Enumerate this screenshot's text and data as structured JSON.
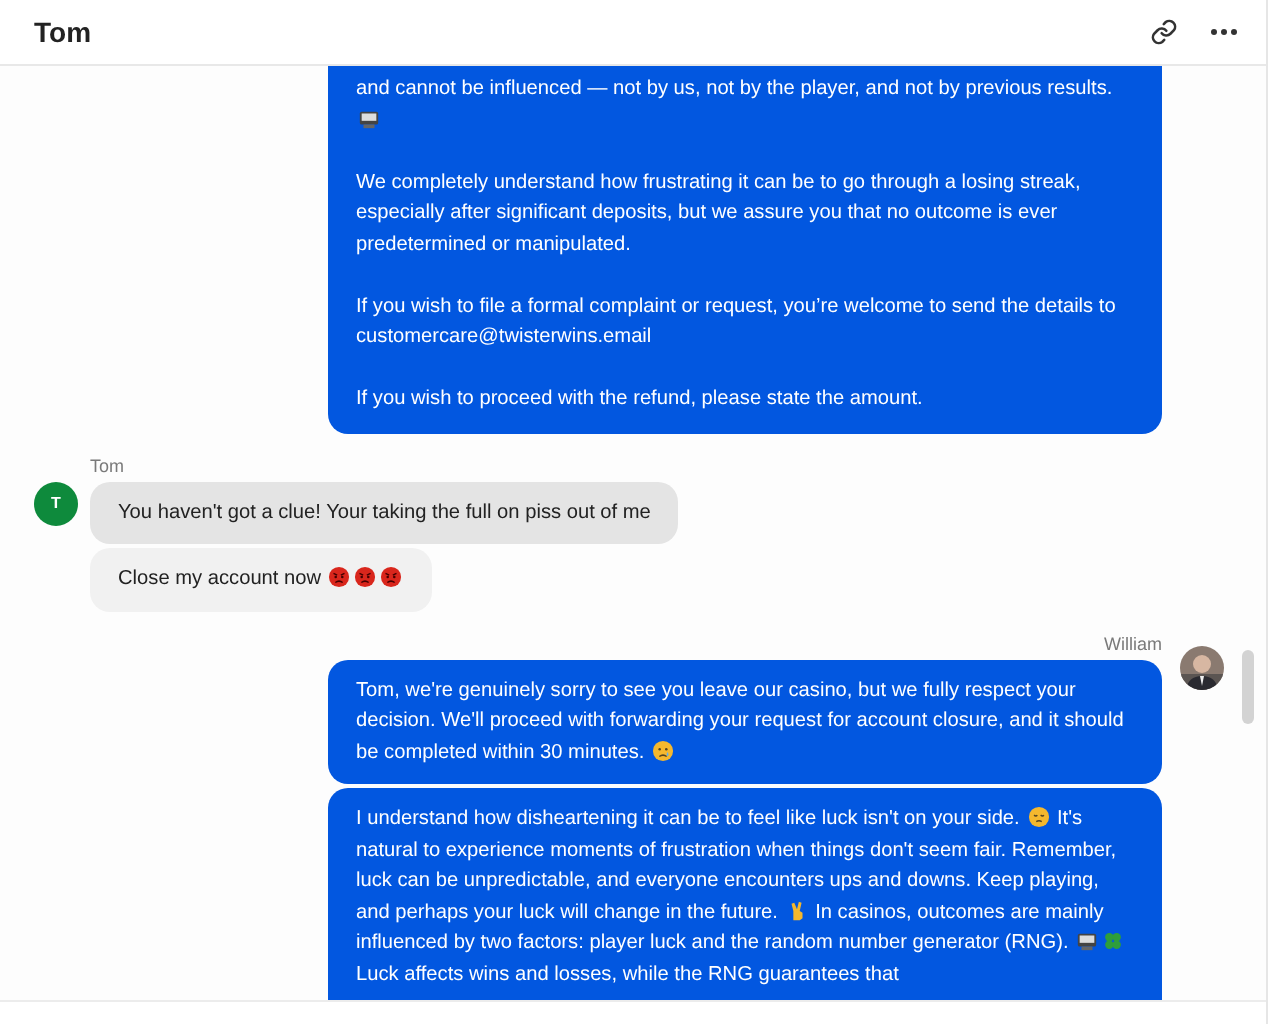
{
  "header": {
    "title": "Tom"
  },
  "messages": [
    {
      "kind": "outgoing",
      "paragraphs": [
        [
          {
            "kind": "text",
            "text": "and cannot be influenced — not by us, not by the player, and not by previous results. "
          },
          {
            "kind": "monitor"
          }
        ],
        [
          {
            "kind": "text",
            "text": "We completely understand how frustrating it can be to go through a losing streak, especially after significant deposits, but we assure you that no outcome is ever predetermined or manipulated."
          }
        ],
        [
          {
            "kind": "text",
            "text": "If you wish to file a formal complaint or request, you’re welcome to send the details to customercare@twisterwins.email"
          }
        ],
        [
          {
            "kind": "text",
            "text": "If you wish to proceed with the refund, please state the amount."
          }
        ]
      ]
    },
    {
      "kind": "incoming",
      "sender": "Tom",
      "avatar": "T",
      "paragraphs": [
        [
          {
            "kind": "text",
            "text": "You haven't got a clue! Your taking the full on piss out of me"
          }
        ]
      ]
    },
    {
      "kind": "incoming",
      "paragraphs": [
        [
          {
            "kind": "text",
            "text": "Close my account now "
          },
          {
            "kind": "angry"
          },
          {
            "kind": "angry"
          },
          {
            "kind": "angry"
          }
        ]
      ]
    },
    {
      "kind": "outgoing",
      "sender": "William",
      "paragraphs": [
        [
          {
            "kind": "text",
            "text": "Tom, we're genuinely sorry to see you leave our casino, but we fully respect your decision. We'll proceed with forwarding your request for account closure, and it should be completed within 30 minutes. "
          },
          {
            "kind": "crying"
          }
        ]
      ]
    },
    {
      "kind": "outgoing",
      "paragraphs": [
        [
          {
            "kind": "text",
            "text": "I understand how disheartening it can be to feel like luck isn't on your side. "
          },
          {
            "kind": "pensive"
          },
          {
            "kind": "text",
            "text": " It's natural to experience moments of frustration when things don't seem fair. Remember, luck can be unpredictable, and everyone encounters ups and downs. Keep playing, and perhaps your luck will change in the future. "
          },
          {
            "kind": "fingers"
          },
          {
            "kind": "text",
            "text": " In casinos, outcomes are mainly influenced by two factors: player luck and the random number generator (RNG). "
          },
          {
            "kind": "monitor"
          },
          {
            "kind": "clover"
          },
          {
            "kind": "text",
            "text": " Luck affects wins and losses, while the RNG guarantees that"
          }
        ]
      ]
    }
  ]
}
